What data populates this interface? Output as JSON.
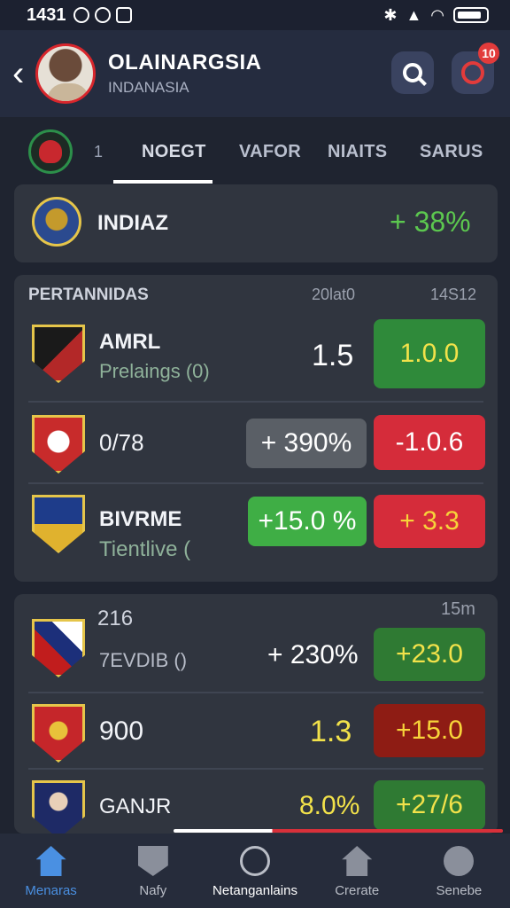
{
  "status_bar": {
    "time": "1431"
  },
  "header": {
    "title": "OLAINARGSIA",
    "subtitle": "INDANASIA",
    "notification_count": "10"
  },
  "tabs": {
    "marker": "1",
    "items": [
      "NOEGT",
      "VAFOR",
      "NIAITS",
      "SARUS"
    ]
  },
  "top_card": {
    "name": "INDIAZ",
    "change": "+ 38%"
  },
  "section1": {
    "label": "PERTANNIDAS",
    "col1": "20lat0",
    "col2": "14S12",
    "rows": [
      {
        "name": "AMRL",
        "sub": "Prelaings (0)",
        "value": "1.5",
        "odd": "1.0.0"
      },
      {
        "name": "0/78",
        "value": "+ 390%",
        "odd": "-1.0.6"
      },
      {
        "name": "BIVRME",
        "sub": "Tientlive (",
        "value": "+15.0 %",
        "odd": "+ 3.3"
      }
    ]
  },
  "section2": {
    "label": "216",
    "col": "15m",
    "rows": [
      {
        "name": "7EVDIB ()",
        "value": "+ 230%",
        "odd": "+23.0"
      },
      {
        "name": "900",
        "value": "1.3",
        "odd": "+15.0"
      },
      {
        "name": "GANJR",
        "value": "8.0%",
        "odd": "+27/6"
      }
    ]
  },
  "bottom_nav": [
    "Menaras",
    "Nafy",
    "Netanganlains",
    "Crerate",
    "Senebe"
  ],
  "colors": {
    "accent": "#4a90e2",
    "green": "#2f8a3a",
    "red": "#d52c3a"
  }
}
